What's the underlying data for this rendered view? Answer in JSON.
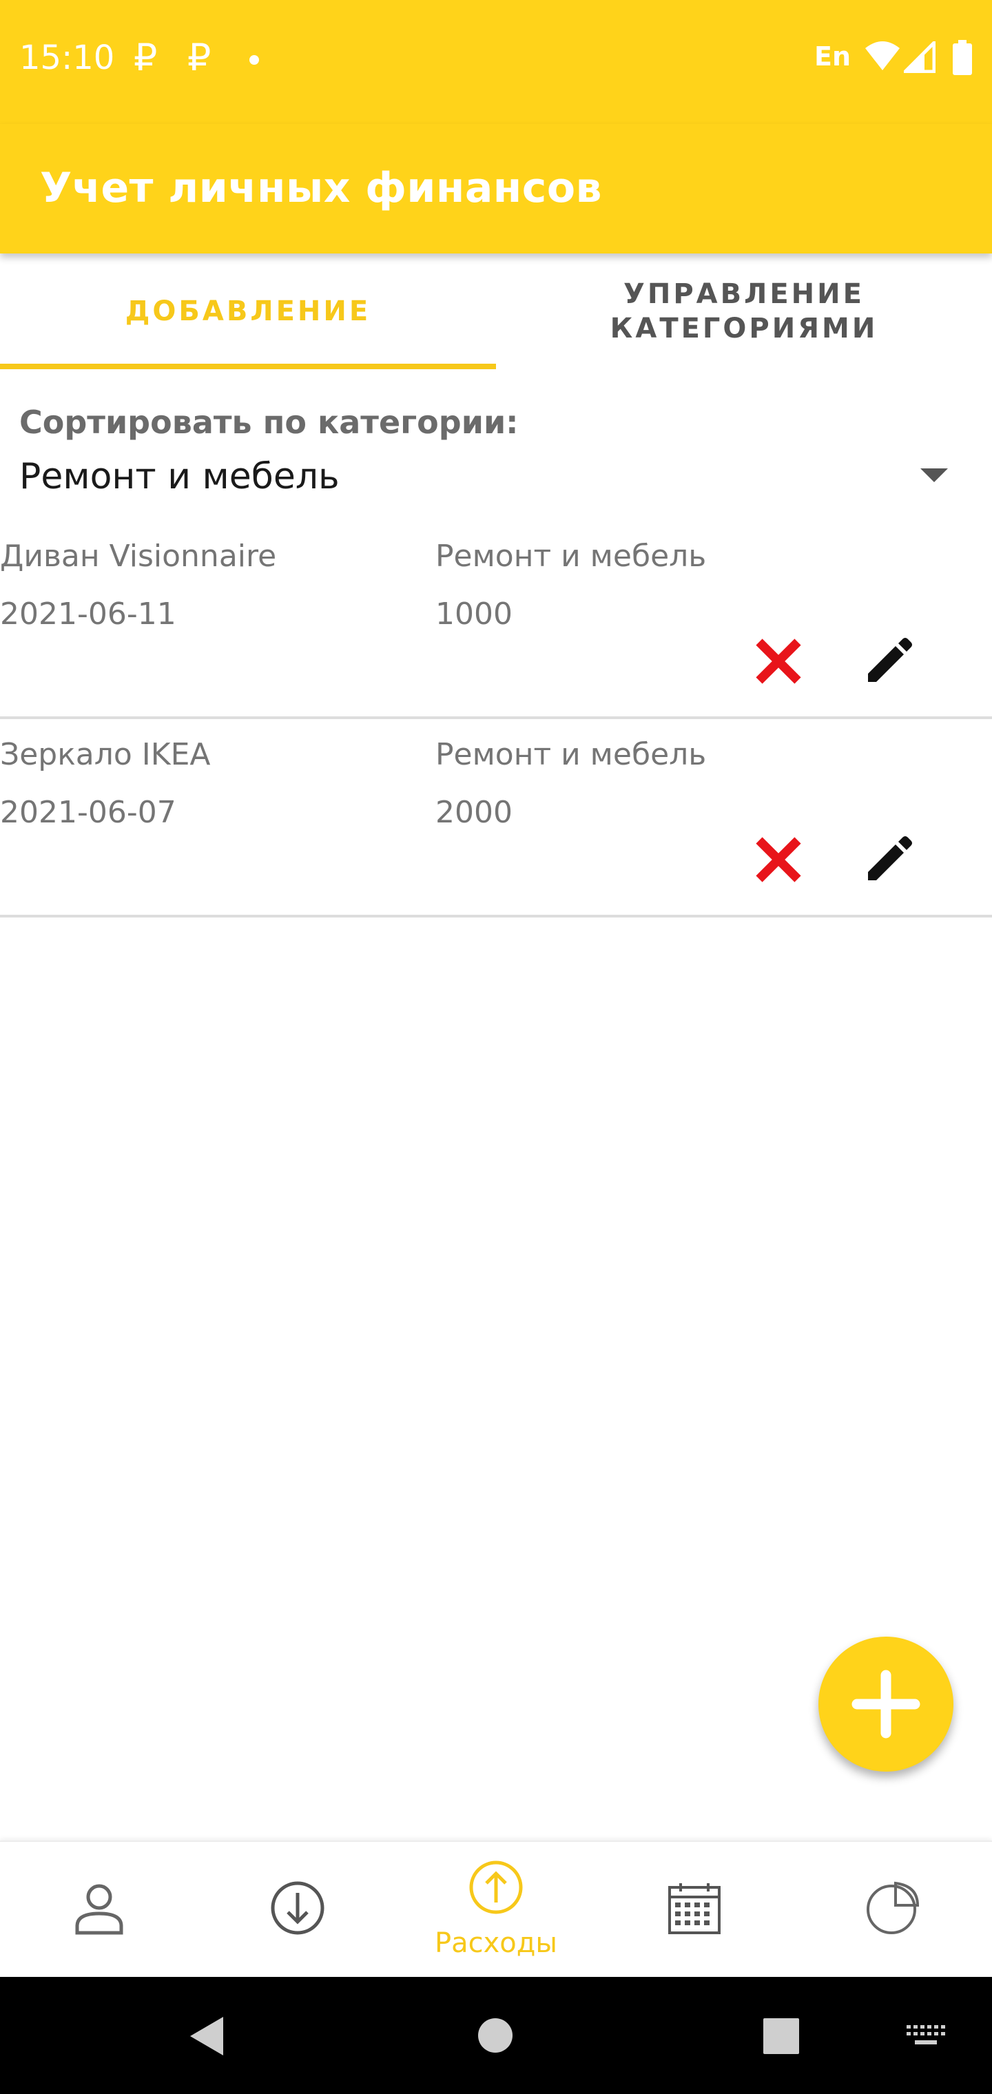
{
  "status_bar": {
    "time": "15:10",
    "notification_icons": [
      "ruble-icon",
      "ruble-icon"
    ],
    "language": "En",
    "right_icons": [
      "wifi-icon",
      "signal-icon",
      "battery-icon"
    ]
  },
  "app_bar": {
    "title": "Учет личных финансов"
  },
  "tabs": [
    {
      "label": "ДОБАВЛЕНИЕ",
      "selected": true
    },
    {
      "label": "УПРАВЛЕНИЕ\nКАТЕГОРИЯМИ",
      "selected": false
    }
  ],
  "filter": {
    "label": "Сортировать по категории:",
    "selected": "Ремонт и мебель"
  },
  "items": [
    {
      "name": "Диван Visionnaire",
      "date": "2021-06-11",
      "category": "Ремонт и мебель",
      "amount": "1000"
    },
    {
      "name": "Зеркало IKEA",
      "date": "2021-06-07",
      "category": "Ремонт и мебель",
      "amount": "2000"
    }
  ],
  "bottom_nav": {
    "items": [
      {
        "icon": "person-icon",
        "label": ""
      },
      {
        "icon": "arrow-down-circle-icon",
        "label": ""
      },
      {
        "icon": "arrow-up-circle-icon",
        "label": "Расходы",
        "selected": true
      },
      {
        "icon": "calendar-icon",
        "label": ""
      },
      {
        "icon": "pie-chart-icon",
        "label": ""
      }
    ]
  },
  "system_nav": [
    "back-icon",
    "home-icon",
    "recents-icon",
    "keyboard-icon"
  ],
  "colors": {
    "accent": "#FFD31A",
    "delete": "#E8141A",
    "tab_selected": "#F7C81A"
  }
}
